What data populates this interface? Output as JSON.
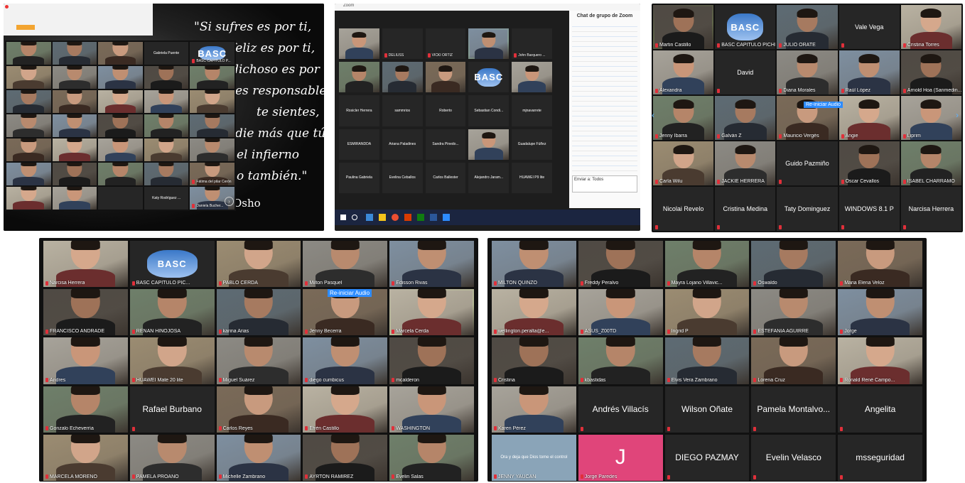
{
  "screens": {
    "s1": {
      "quote_lines": [
        "\"Si sufres es por ti,",
        "feliz es por ti,",
        "dichoso es por ti.",
        "es responsable",
        "te sientes,",
        "die más que tú.",
        "el infierno",
        "o también.\""
      ],
      "quote_author": "Osho",
      "tiles": [
        "",
        "",
        "",
        "Gabriela Puente",
        "BASC CAPITULO P...",
        "",
        "",
        "",
        "",
        "",
        "",
        "",
        "",
        "",
        "",
        "",
        "",
        "",
        "",
        "",
        "",
        "",
        "",
        "",
        "",
        "",
        "",
        "",
        "",
        "Fátima del pilar Cerón",
        "",
        "",
        "",
        "Katy Rodríguez ...",
        "Daniela Bucher..."
      ]
    },
    "s2": {
      "window_title": "Zoom",
      "chat_title": "Chat de grupo de Zoom",
      "chat_input": "Enviar a: Todos",
      "tiles": [
        "",
        "DELIUSS",
        "VICKI ORTIZ",
        "",
        "John Barquero ...",
        "",
        "",
        "",
        "",
        "",
        "Rosicler Herrera",
        "sammrios",
        "Roberto",
        "Sebastian Condi...",
        "mjnavarrete",
        "ESMIRANDDA",
        "Ariana Paladines",
        "Sandra Pinedo...",
        "",
        "Guadalupe Fúñez",
        "Paulina Gabriela",
        "Evelina Ceballos",
        "Carlos Ballester",
        "Alejandro Jaram...",
        "HUAWEI P9 lite"
      ]
    },
    "s3": {
      "tiles": [
        "Martin Castillo",
        "BASC CAPITULO PICHINCHA",
        "JULIO ORATE",
        "Vale Vega",
        "Cristina Torres",
        "Alexandra",
        "David",
        "Diana Morales",
        "Raúl López",
        "Arnold Hoa (Sanmedin...",
        "Jenny Ibarra",
        "Galván Z",
        "Mauricio Vergés",
        "Angie",
        "Liprim",
        "Carla Wilu",
        "JACKIE HERRERA",
        "Guido Pazmiño",
        "Oscar Cevallos",
        "ISABEL CHARRAMO",
        "Nicolai Revelo",
        "Cristina Medina",
        "Taty Dominguez",
        "WINDOWS 8.1 P",
        "Narcisa Herrera"
      ],
      "banner": "Re-iniciar Audio"
    },
    "s4": {
      "tiles": [
        "Narcisa Herrera",
        "BASC CAPITULO PIC...",
        "PABLO CERDA",
        "Milton Pasquel",
        "Edisson Rivas",
        "FRANCISCO ANDRADE",
        "RENAN HINOJOSA",
        "karina Arias",
        "Jenny Becerra",
        "Marcela Cerda",
        "Andres",
        "HUAWEI Mate 20 lite",
        "Miguel Suárez",
        "diego cumbicus",
        "mcalderon",
        "Gonzalo Echeverría",
        "Rafael Burbano",
        "Carlos Reyes",
        "Efrén Castillo",
        "WASHINGTON",
        "MARCELA MORENO",
        "PAMELA PROAÑO",
        "Michelle Zambrano",
        "AYRTON RAMIREZ",
        "Evelin Salas"
      ],
      "banner": "Re-iniciar Audio",
      "logo_text": "BASC"
    },
    "s5": {
      "tiles": [
        "MILTON QUINZO",
        "Freddy Peralvo",
        "Mayra Lojano Villavic...",
        "Oswaldo",
        "Maria Elena Veloz",
        "wellington.peralta@e...",
        "ASUS_Z00TD",
        "Ingrid P",
        "ESTEFANIA AGUIRRE",
        "Jorge",
        "Cristina",
        "kbastidas",
        "Elvis Vera Zambrano",
        "Lorena Cruz",
        "Ronald René Campo...",
        "Karen Pérez",
        "Andrés Villacís",
        "Wilson Oñate",
        "Pamela Montalvo...",
        "Angelita",
        "JENNY YAUCAN",
        "Jorge Paredes",
        "DIEGO PAZMAY",
        "Evelin Velasco",
        "msseguridad"
      ],
      "avatar_letter": "J",
      "slide_text": "Ora y deja que Dios tome el control"
    }
  }
}
